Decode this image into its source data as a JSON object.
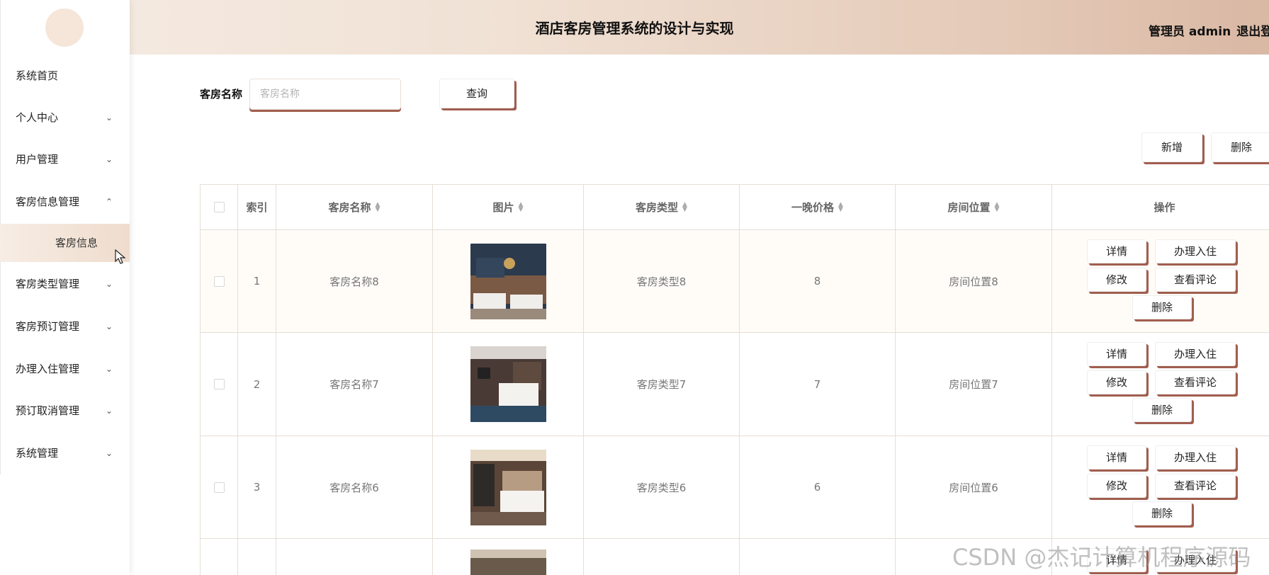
{
  "header": {
    "title": "酒店客房管理系统的设计与实现",
    "user_label": "管理员 admin",
    "logout_label": "退出登录"
  },
  "sidebar": {
    "items": [
      {
        "label": "系统首页",
        "chevron": ""
      },
      {
        "label": "个人中心",
        "chevron": "⌄"
      },
      {
        "label": "用户管理",
        "chevron": "⌄"
      },
      {
        "label": "客房信息管理",
        "chevron": "⌃"
      },
      {
        "label": "客房类型管理",
        "chevron": "⌄"
      },
      {
        "label": "客房预订管理",
        "chevron": "⌄"
      },
      {
        "label": "办理入住管理",
        "chevron": "⌄"
      },
      {
        "label": "预订取消管理",
        "chevron": "⌄"
      },
      {
        "label": "系统管理",
        "chevron": "⌄"
      }
    ],
    "active_sub": "客房信息"
  },
  "search": {
    "label": "客房名称",
    "placeholder": "客房名称",
    "button": "查询"
  },
  "actions": {
    "add": "新增",
    "delete": "删除"
  },
  "table": {
    "headers": [
      "",
      "索引",
      "客房名称",
      "图片",
      "客房类型",
      "一晚价格",
      "房间位置",
      "操作"
    ],
    "rows": [
      {
        "index": "1",
        "name": "客房名称8",
        "type": "客房类型8",
        "price": "8",
        "location": "房间位置8"
      },
      {
        "index": "2",
        "name": "客房名称7",
        "type": "客房类型7",
        "price": "7",
        "location": "房间位置7"
      },
      {
        "index": "3",
        "name": "客房名称6",
        "type": "客房类型6",
        "price": "6",
        "location": "房间位置6"
      },
      {
        "index": "",
        "name": "",
        "type": "",
        "price": "",
        "location": ""
      }
    ],
    "ops": {
      "detail": "详情",
      "checkin": "办理入住",
      "edit": "修改",
      "review": "查看评论",
      "delete": "删除"
    }
  },
  "watermark": "CSDN @杰记计算机程序源码",
  "colors": {
    "accent_shadow": "#a15e4f",
    "header_start": "#f6ece4",
    "header_end": "#d9b8a4"
  }
}
